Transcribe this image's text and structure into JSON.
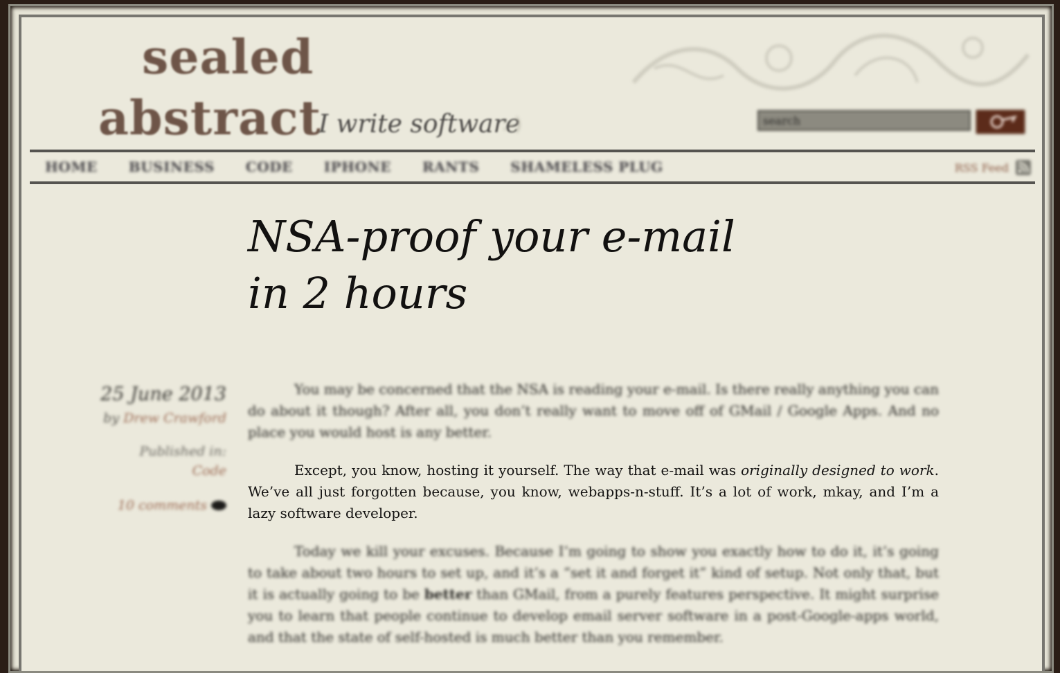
{
  "site": {
    "logo_line1": "sealed",
    "logo_line2": "abstract",
    "tagline": "I write software",
    "tagline_glyph": ":-)"
  },
  "search": {
    "placeholder": "search",
    "value": "",
    "button_icon": "search-arrow-icon"
  },
  "nav": {
    "items": [
      {
        "label": "HOME"
      },
      {
        "label": "BUSINESS"
      },
      {
        "label": "CODE"
      },
      {
        "label": "IPHONE"
      },
      {
        "label": "RANTS"
      },
      {
        "label": "SHAMELESS PLUG"
      }
    ],
    "rss_label": "RSS Feed",
    "rss_icon": "rss-icon"
  },
  "post": {
    "title": "NSA-proof your e-mail in 2 hours",
    "date": "25 June 2013",
    "by_prefix": "by",
    "author": "Drew Crawford",
    "published_in_label": "Published in:",
    "category": "Code",
    "comments": "10 comments",
    "comments_icon": "speech-bubble-icon",
    "paragraphs": {
      "p1": "You may be concerned that the NSA is reading your e-mail. Is there really anything you can do about it though? After all, you don’t really want to move off of GMail / Google Apps. And no place you would host is any better.",
      "p2_start": "Except, you know, hosting it yourself. The way that e-mail was ",
      "p2_em": "originally designed to work",
      "p2_end": ". We’ve all just forgotten because, you know, webapps-n-stuff. It’s a lot of work, mkay, and I’m a lazy software developer.",
      "p3_start": "Today we kill your excuses. Because I’m going to show you exactly how to do it, it’s going to take about two hours to set up, and it’s a “set it and forget it” kind of setup. Not only that, but it is actually going to be ",
      "p3_strong": "better",
      "p3_end": " than GMail, from a purely features perspective. It might surprise you to learn that people continue to develop email server software in a post-Google-apps world, and that the state of self-hosted is much better than you remember."
    }
  },
  "colors": {
    "page_bg": "#ebe9dc",
    "outer_bg": "#2a1d16",
    "accent_link": "#9b6a54",
    "logo": "#6e5548",
    "search_button": "#5c2b1a"
  }
}
